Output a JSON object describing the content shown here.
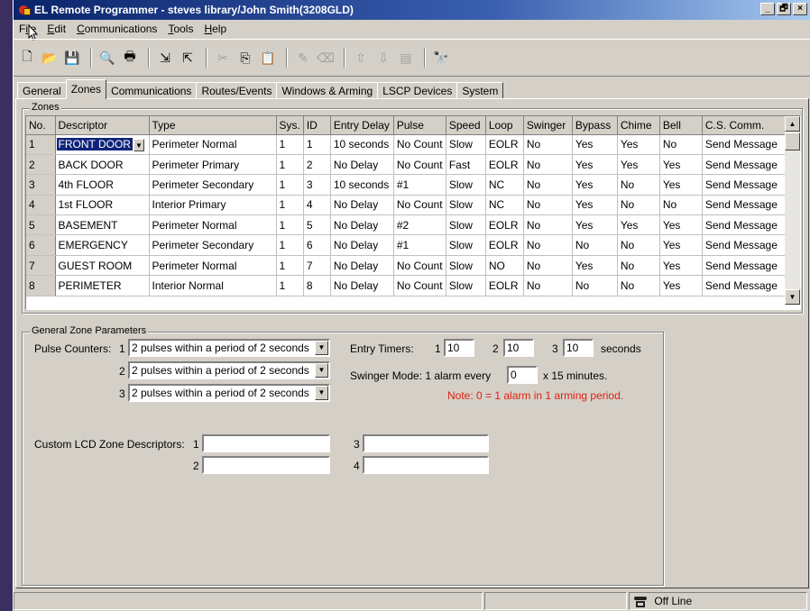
{
  "window": {
    "title": "EL Remote Programmer - steves library/John Smith(3208GLD)",
    "controls": [
      "_",
      "🗗",
      "×"
    ]
  },
  "menu": [
    {
      "label": "File",
      "underline": "i"
    },
    {
      "label": "Edit",
      "underline": "E"
    },
    {
      "label": "Communications",
      "underline": "C"
    },
    {
      "label": "Tools",
      "underline": "T"
    },
    {
      "label": "Help",
      "underline": "H"
    }
  ],
  "toolbar": [
    {
      "name": "new-icon",
      "glyph": "🗋",
      "disabled": false
    },
    {
      "name": "open-icon",
      "glyph": "📂",
      "disabled": false
    },
    {
      "name": "save-icon",
      "glyph": "💾",
      "disabled": false
    },
    {
      "sep": true
    },
    {
      "name": "print-preview-icon",
      "glyph": "🔍",
      "disabled": false
    },
    {
      "name": "print-icon",
      "glyph": "🖶",
      "disabled": false
    },
    {
      "sep": true
    },
    {
      "name": "download-icon",
      "glyph": "⇲",
      "disabled": false
    },
    {
      "name": "upload-icon",
      "glyph": "⇱",
      "disabled": false
    },
    {
      "sep": true
    },
    {
      "name": "cut-icon",
      "glyph": "✂",
      "disabled": true
    },
    {
      "name": "copy-icon",
      "glyph": "⎘",
      "disabled": false
    },
    {
      "name": "paste-icon",
      "glyph": "📋",
      "disabled": true
    },
    {
      "sep": true
    },
    {
      "name": "edit-icon",
      "glyph": "✎",
      "disabled": true
    },
    {
      "name": "erase-icon",
      "glyph": "⌫",
      "disabled": true
    },
    {
      "sep": true
    },
    {
      "name": "move-up-icon",
      "glyph": "⇧",
      "disabled": true
    },
    {
      "name": "move-down-icon",
      "glyph": "⇩",
      "disabled": true
    },
    {
      "name": "properties-icon",
      "glyph": "▤",
      "disabled": true
    },
    {
      "sep": true
    },
    {
      "name": "find-icon",
      "glyph": "🔭",
      "disabled": false
    }
  ],
  "tabs": [
    {
      "label": "General",
      "active": false
    },
    {
      "label": "Zones",
      "active": true
    },
    {
      "label": "Communications",
      "active": false
    },
    {
      "label": "Routes/Events",
      "active": false
    },
    {
      "label": "Windows & Arming",
      "active": false
    },
    {
      "label": "LSCP Devices",
      "active": false
    },
    {
      "label": "System",
      "active": false
    }
  ],
  "zones": {
    "group_label": "Zones",
    "columns": [
      "No.",
      "Descriptor",
      "Type",
      "Sys.",
      "ID",
      "Entry Delay",
      "Pulse",
      "Speed",
      "Loop",
      "Swinger",
      "Bypass",
      "Chime",
      "Bell",
      "C.S. Comm."
    ],
    "rows": [
      [
        "1",
        "FRONT DOOR",
        "Perimeter Normal",
        "1",
        "1",
        "10 seconds",
        "No Count",
        "Slow",
        "EOLR",
        "No",
        "Yes",
        "Yes",
        "No",
        "Send Message"
      ],
      [
        "2",
        "BACK DOOR",
        "Perimeter Primary",
        "1",
        "2",
        "No Delay",
        "No Count",
        "Fast",
        "EOLR",
        "No",
        "Yes",
        "Yes",
        "Yes",
        "Send Message"
      ],
      [
        "3",
        "4th FLOOR",
        "Perimeter Secondary",
        "1",
        "3",
        "10 seconds",
        "#1",
        "Slow",
        "NC",
        "No",
        "Yes",
        "No",
        "Yes",
        "Send Message"
      ],
      [
        "4",
        "1st FLOOR",
        "Interior Primary",
        "1",
        "4",
        "No Delay",
        "No Count",
        "Slow",
        "NC",
        "No",
        "Yes",
        "No",
        "No",
        "Send Message"
      ],
      [
        "5",
        "BASEMENT",
        "Perimeter Normal",
        "1",
        "5",
        "No Delay",
        "#2",
        "Slow",
        "EOLR",
        "No",
        "Yes",
        "Yes",
        "Yes",
        "Send Message"
      ],
      [
        "6",
        "EMERGENCY",
        "Perimeter Secondary",
        "1",
        "6",
        "No Delay",
        "#1",
        "Slow",
        "EOLR",
        "No",
        "No",
        "No",
        "Yes",
        "Send Message"
      ],
      [
        "7",
        "GUEST ROOM",
        "Perimeter Normal",
        "1",
        "7",
        "No Delay",
        "No Count",
        "Slow",
        "NO",
        "No",
        "Yes",
        "No",
        "Yes",
        "Send Message"
      ],
      [
        "8",
        "PERIMETER",
        "Interior Normal",
        "1",
        "8",
        "No Delay",
        "No Count",
        "Slow",
        "EOLR",
        "No",
        "No",
        "No",
        "Yes",
        "Send Message"
      ]
    ]
  },
  "params": {
    "group_label": "General Zone Parameters",
    "pulse_label": "Pulse Counters:",
    "pulse_counters": [
      {
        "n": "1",
        "value": "2 pulses within a period of 2 seconds"
      },
      {
        "n": "2",
        "value": "2 pulses within a period of 2 seconds"
      },
      {
        "n": "3",
        "value": "2 pulses within a period of 2 seconds"
      }
    ],
    "entry_label": "Entry Timers:",
    "entry_timers": [
      {
        "n": "1",
        "value": "10"
      },
      {
        "n": "2",
        "value": "10"
      },
      {
        "n": "3",
        "value": "10"
      }
    ],
    "entry_unit": "seconds",
    "swinger_label": "Swinger Mode: 1 alarm every",
    "swinger_value": "0",
    "swinger_unit": "x 15 minutes.",
    "note": "Note: 0 = 1 alarm in 1 arming period.",
    "lcd_label": "Custom LCD Zone Descriptors:",
    "lcd": [
      {
        "n": "1",
        "value": ""
      },
      {
        "n": "2",
        "value": ""
      },
      {
        "n": "3",
        "value": ""
      },
      {
        "n": "4",
        "value": ""
      }
    ]
  },
  "status": {
    "connection": "Off Line"
  }
}
